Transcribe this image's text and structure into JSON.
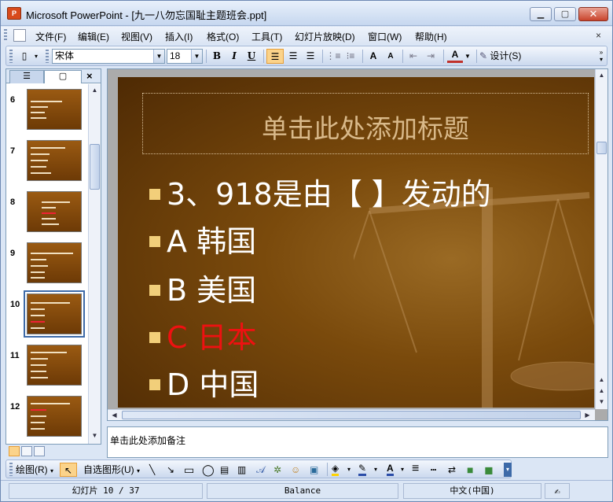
{
  "window": {
    "title": "Microsoft PowerPoint - [九一八勿忘国耻主题班会.ppt]",
    "icon": "powerpoint-icon"
  },
  "menubar": {
    "items": [
      "文件(F)",
      "编辑(E)",
      "视图(V)",
      "插入(I)",
      "格式(O)",
      "工具(T)",
      "幻灯片放映(D)",
      "窗口(W)",
      "帮助(H)"
    ],
    "close_glyph": "×"
  },
  "toolbar": {
    "font_name": "宋体",
    "font_size": "18",
    "bold": "B",
    "italic": "I",
    "underline": "U",
    "grow_font": "A",
    "shrink_font": "A",
    "font_color": "A",
    "design_label": "设计(S)"
  },
  "left_pane": {
    "close_glyph": "×",
    "slides": [
      {
        "num": "6",
        "selected": false
      },
      {
        "num": "7",
        "selected": false
      },
      {
        "num": "8",
        "selected": false
      },
      {
        "num": "9",
        "selected": false
      },
      {
        "num": "10",
        "selected": true
      },
      {
        "num": "11",
        "selected": false
      },
      {
        "num": "12",
        "selected": false
      }
    ]
  },
  "slide": {
    "title_placeholder": "单击此处添加标题",
    "bullets": [
      {
        "text": "3、918是由【     】发动的",
        "color": "#ffffff"
      },
      {
        "text": "A  韩国",
        "color": "#ffffff"
      },
      {
        "text": "B   美国",
        "color": "#ffffff"
      },
      {
        "text": "C   日本",
        "color": "#e11111"
      },
      {
        "text": "D   中国",
        "color": "#ffffff"
      }
    ]
  },
  "notes": {
    "placeholder": "单击此处添加备注"
  },
  "drawbar": {
    "draw_label": "绘图(R)",
    "autoshapes_label": "自选图形(U)"
  },
  "status": {
    "slide_info": "幻灯片 10 / 37",
    "design": "Balance",
    "language": "中文(中国)"
  },
  "colors": {
    "accent": "#3d6aa8",
    "slide_bg": "#7a4a0c",
    "answer_red": "#e11111"
  }
}
